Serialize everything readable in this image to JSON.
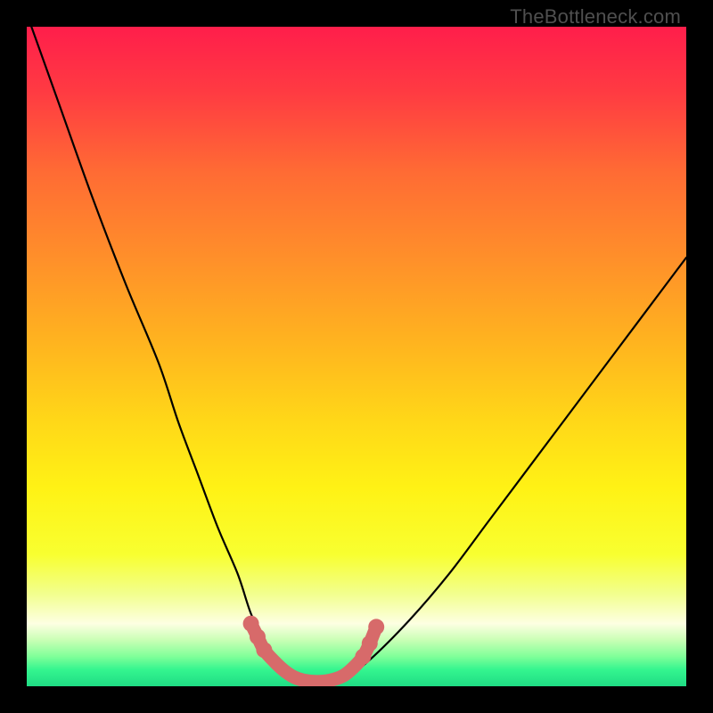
{
  "watermark": "TheBottleneck.com",
  "chart_data": {
    "type": "line",
    "title": "",
    "xlabel": "",
    "ylabel": "",
    "xlim": [
      0,
      100
    ],
    "ylim": [
      0,
      100
    ],
    "series": [
      {
        "name": "bottleneck-curve",
        "x": [
          0,
          5,
          10,
          15,
          20,
          23,
          26,
          29,
          32,
          34,
          36,
          38,
          40,
          43,
          45,
          48,
          52,
          58,
          64,
          70,
          76,
          82,
          88,
          94,
          100
        ],
        "values": [
          102,
          88,
          74,
          61,
          49,
          40,
          32,
          24,
          17,
          11,
          7,
          3,
          1,
          0,
          0,
          1,
          4,
          10,
          17,
          25,
          33,
          41,
          49,
          57,
          65
        ]
      },
      {
        "name": "optimal-marker",
        "x": [
          34,
          35,
          36,
          37.5,
          39,
          40.5,
          42,
          44,
          46,
          48,
          49.5,
          51,
          52,
          53
        ],
        "values": [
          9.5,
          7.5,
          5.5,
          3.8,
          2.4,
          1.4,
          0.9,
          0.7,
          0.9,
          1.6,
          2.8,
          4.5,
          6.5,
          9.0
        ]
      }
    ],
    "gradient_stops": [
      {
        "offset": 0.0,
        "color": "#ff1e4b"
      },
      {
        "offset": 0.1,
        "color": "#ff3b42"
      },
      {
        "offset": 0.22,
        "color": "#ff6b34"
      },
      {
        "offset": 0.35,
        "color": "#ff8f2a"
      },
      {
        "offset": 0.48,
        "color": "#ffb41f"
      },
      {
        "offset": 0.6,
        "color": "#ffd818"
      },
      {
        "offset": 0.7,
        "color": "#fff215"
      },
      {
        "offset": 0.8,
        "color": "#f8ff30"
      },
      {
        "offset": 0.86,
        "color": "#f2ff8e"
      },
      {
        "offset": 0.905,
        "color": "#fdffe2"
      },
      {
        "offset": 0.93,
        "color": "#c9ffb5"
      },
      {
        "offset": 0.955,
        "color": "#7fff99"
      },
      {
        "offset": 0.975,
        "color": "#34f58f"
      },
      {
        "offset": 1.0,
        "color": "#1fdc84"
      }
    ],
    "marker_color": "#d76a6a",
    "curve_color": "#000000"
  }
}
